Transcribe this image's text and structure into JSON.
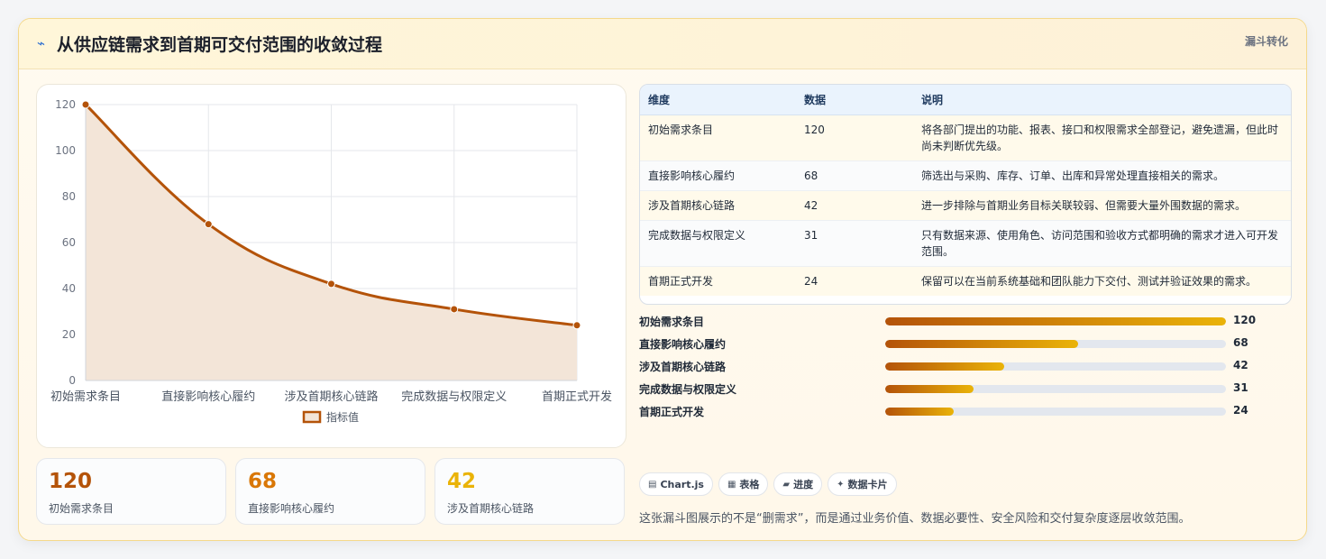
{
  "header": {
    "icon": "wave-icon",
    "title": "从供应链需求到首期可交付范围的收敛过程",
    "tag": "漏斗转化"
  },
  "chart_data": {
    "type": "area",
    "categories": [
      "初始需求条目",
      "直接影响核心履约",
      "涉及首期核心链路",
      "完成数据与权限定义",
      "首期正式开发"
    ],
    "series": [
      {
        "name": "指标值",
        "values": [
          120,
          68,
          42,
          31,
          24
        ]
      }
    ],
    "ylim": [
      0,
      120
    ],
    "yticks": [
      0,
      20,
      40,
      60,
      80,
      100,
      120
    ],
    "legend": "bottom",
    "grid": true,
    "colors": {
      "line": "#b45309",
      "fill": "#f3e5d8"
    }
  },
  "stats": [
    {
      "value": "120",
      "label": "初始需求条目",
      "color": "#b45309"
    },
    {
      "value": "68",
      "label": "直接影响核心履约",
      "color": "#d97706"
    },
    {
      "value": "42",
      "label": "涉及首期核心链路",
      "color": "#eab308"
    }
  ],
  "table": {
    "headers": [
      "维度",
      "数据",
      "说明"
    ],
    "rows": [
      {
        "dim": "初始需求条目",
        "value": "120",
        "desc": "将各部门提出的功能、报表、接口和权限需求全部登记，避免遗漏，但此时尚未判断优先级。"
      },
      {
        "dim": "直接影响核心履约",
        "value": "68",
        "desc": "筛选出与采购、库存、订单、出库和异常处理直接相关的需求。"
      },
      {
        "dim": "涉及首期核心链路",
        "value": "42",
        "desc": "进一步排除与首期业务目标关联较弱、但需要大量外围数据的需求。"
      },
      {
        "dim": "完成数据与权限定义",
        "value": "31",
        "desc": "只有数据来源、使用角色、访问范围和验收方式都明确的需求才进入可开发范围。"
      },
      {
        "dim": "首期正式开发",
        "value": "24",
        "desc": "保留可以在当前系统基础和团队能力下交付、测试并验证效果的需求。"
      }
    ]
  },
  "progress": {
    "max": 120,
    "items": [
      {
        "label": "初始需求条目",
        "value": 120
      },
      {
        "label": "直接影响核心履约",
        "value": 68
      },
      {
        "label": "涉及首期核心链路",
        "value": 42
      },
      {
        "label": "完成数据与权限定义",
        "value": 31
      },
      {
        "label": "首期正式开发",
        "value": 24
      }
    ]
  },
  "chips": [
    {
      "icon": "chart-icon",
      "glyph": "▤",
      "label": "Chart.js"
    },
    {
      "icon": "table-icon",
      "glyph": "▦",
      "label": "表格"
    },
    {
      "icon": "progress-icon",
      "glyph": "▰",
      "label": "进度"
    },
    {
      "icon": "sparkle-icon",
      "glyph": "✦",
      "label": "数据卡片"
    }
  ],
  "note": "这张漏斗图展示的不是“删需求”，而是通过业务价值、数据必要性、安全风险和交付复杂度逐层收敛范围。"
}
